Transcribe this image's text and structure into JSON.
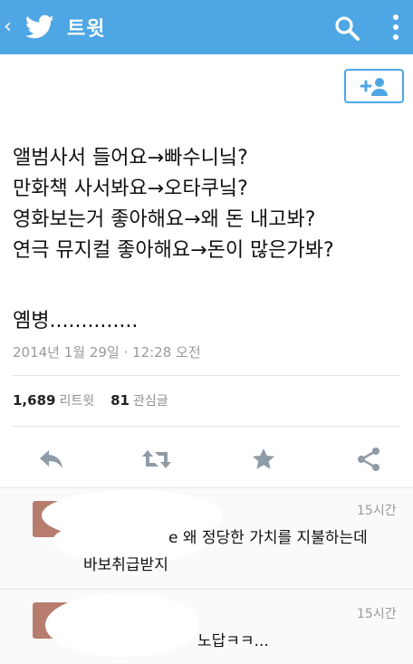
{
  "header": {
    "back": "‹",
    "title": "트윗",
    "logo": "twitter-bird-icon",
    "search_icon": "search-icon",
    "more_icon": "more-vertical-icon"
  },
  "tweet": {
    "lines": [
      "앨범사서 들어요→빠수니닠?",
      "만화책 사서봐요→오타쿠닠?",
      "영화보는거 좋아해요→왜 돈 내고봐?",
      "연극 뮤지컬 좋아해요→돈이 많은가봐?"
    ],
    "tail": "옘병..............",
    "timestamp": "2014년 1월 29일 · 12:28 오전",
    "retweets": "1,689",
    "retweets_label": "리트윗",
    "favorites": "81",
    "favorites_label": "관심글"
  },
  "actions": [
    "reply-icon",
    "retweet-icon",
    "favorite-star-icon",
    "share-icon"
  ],
  "replies": [
    {
      "time": "15시간",
      "line1": "e 왜 정당한 가치를 지불하는데",
      "line2": "바보취급받지"
    },
    {
      "time": "15시간",
      "line1": "노답ㅋㅋ...",
      "line2": ""
    }
  ],
  "colors": {
    "accent": "#4ea7e4",
    "header_bg": "#4ea7e4"
  }
}
